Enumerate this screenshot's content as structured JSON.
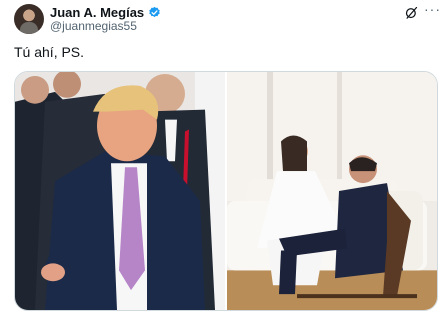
{
  "author": {
    "name": "Juan A. Megías",
    "handle": "@juanmegias55",
    "verified": true,
    "verified_icon": "verified-badge-icon"
  },
  "tweet": {
    "text": "Tú ahí, PS."
  },
  "actions": {
    "grok_icon": "grok-icon",
    "more_icon": "more-options-icon",
    "more_glyph": "···"
  },
  "media": {
    "count": 2,
    "photos": [
      {
        "subject": "man in blue suit and pink tie pointing, with people behind"
      },
      {
        "subject": "woman in white dress seated on white sofa, man in dark suit seated in chair"
      }
    ]
  },
  "colors": {
    "accent": "#1d9bf0",
    "text": "#0f1419",
    "secondary": "#536471"
  }
}
